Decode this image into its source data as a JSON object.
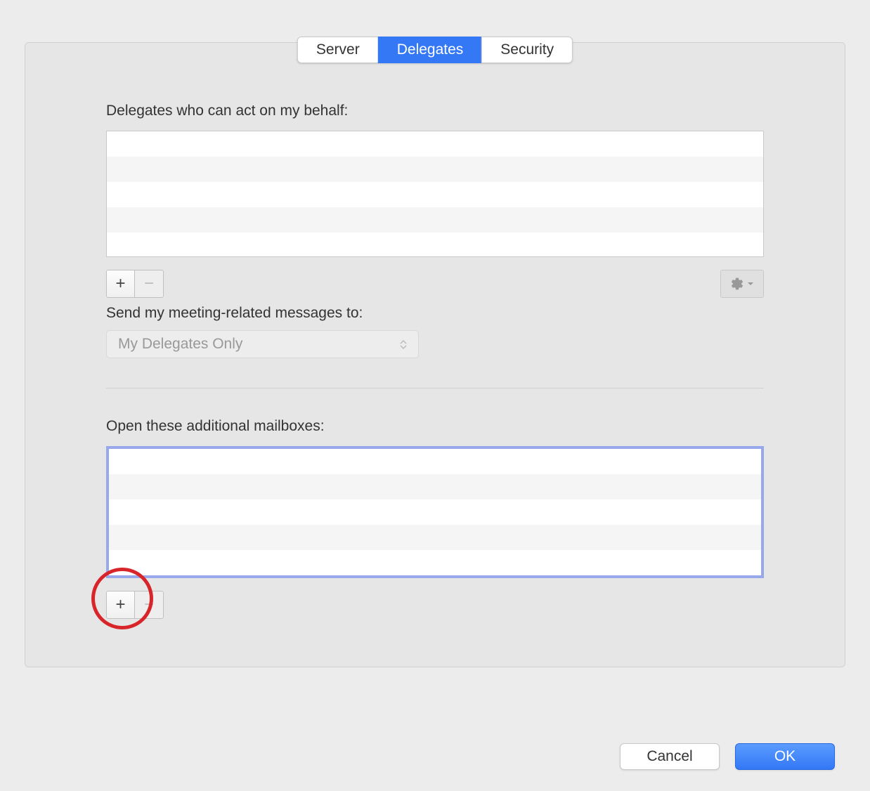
{
  "tabs": {
    "server": "Server",
    "delegates": "Delegates",
    "security": "Security"
  },
  "delegates_section": {
    "label": "Delegates who can act on my behalf:",
    "meeting_label": "Send my meeting-related messages to:",
    "meeting_dropdown": "My Delegates Only"
  },
  "mailboxes_section": {
    "label": "Open these additional mailboxes:"
  },
  "footer": {
    "cancel": "Cancel",
    "ok": "OK"
  },
  "icons": {
    "plus": "+",
    "minus": "−"
  }
}
